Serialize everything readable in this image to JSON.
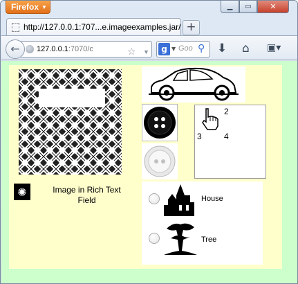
{
  "browser": {
    "app_button": "Firefox",
    "tab_title": "http://127.0.0.1:707...e.imageexamples.jar/",
    "new_tab": "+",
    "url_host": "127.0.0.1",
    "url_rest": ":7070/c",
    "search_placeholder": "Goo"
  },
  "page": {
    "rich_text_label": "Image in Rich Text  Field",
    "cursor_numbers": [
      "2",
      "3",
      "4"
    ],
    "radio_options": [
      {
        "label": "House",
        "icon": "house-icon"
      },
      {
        "label": "Tree",
        "icon": "tree-icon"
      }
    ]
  },
  "colors": {
    "background_outer": "#ccffcc",
    "background_panel": "#ffffcc",
    "firefox_orange": "#e3701a"
  }
}
